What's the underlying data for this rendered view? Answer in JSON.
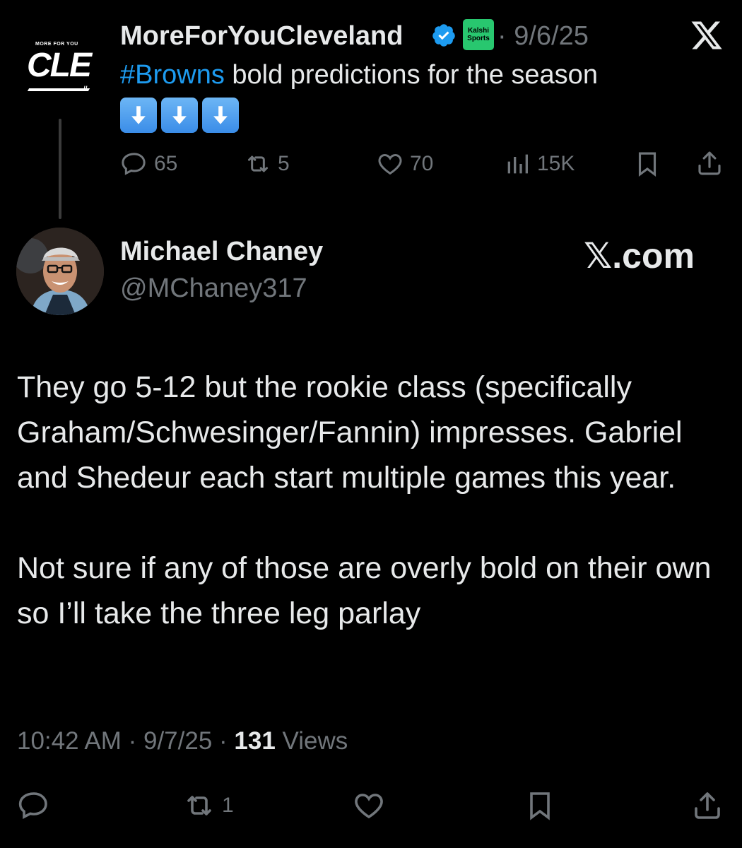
{
  "parent_tweet": {
    "logo": {
      "small": "MORE FOR YOU",
      "big": "CLE",
      "slashes": "//"
    },
    "author": "MoreForYouCleveland",
    "badge_line1": "Kalshi",
    "badge_line2": "Sports",
    "date": "· 9/6/25",
    "hashtag": "#Browns",
    "text": " bold predictions for the season",
    "emojis": [
      "down-arrow",
      "down-arrow",
      "down-arrow"
    ],
    "replies": "65",
    "reposts": "5",
    "likes": "70",
    "views": "15K"
  },
  "reply": {
    "name": "Michael Chaney",
    "handle": "@MChaney317",
    "watermark": "𝕏.com",
    "paragraph1": "They go 5-12 but the rookie class (specifically Graham/Schwesinger/Fannin) impresses. Gabriel and Shedeur each start multiple games this year.",
    "paragraph2": "Not sure if any of those are overly bold on their own so I’ll take the three leg parlay",
    "time": "10:42 AM · 9/7/25 · ",
    "view_count": "131",
    "views_label": " Views",
    "reposts": "1"
  },
  "colors": {
    "accent": "#1d9bf0",
    "muted": "#71767b",
    "text": "#e7e9ea",
    "background": "#000000"
  }
}
